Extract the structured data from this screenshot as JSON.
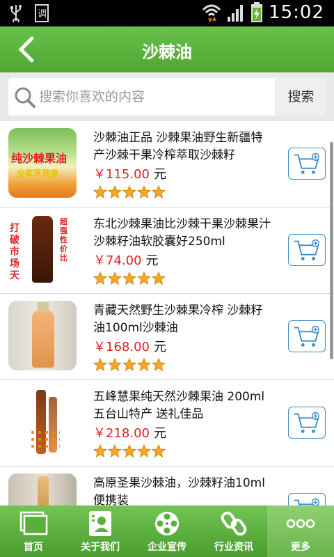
{
  "status_bar": {
    "time": "15:02"
  },
  "header": {
    "title": "沙棘油"
  },
  "search": {
    "placeholder": "搜索你喜欢的内容",
    "button_label": "搜索"
  },
  "products": [
    {
      "name": "沙棘油正品 沙棘果油野生新疆特产沙棘干果冷榨萃取沙棘籽",
      "price": "￥115.00",
      "unit": "元",
      "rating": 5,
      "thumb_text": "纯沙棘果油",
      "thumb_sub": "全家享健康"
    },
    {
      "name": "东北沙棘果油比沙棘干果沙棘果汁沙棘籽油软胶囊好250ml",
      "price": "￥74.00",
      "unit": "元",
      "rating": 5,
      "thumb_text": "打破市场天",
      "thumb_sub": "超强性价比"
    },
    {
      "name": "青藏天然野生沙棘果冷榨 沙棘籽油100ml沙棘油",
      "price": "￥168.00",
      "unit": "元",
      "rating": 5,
      "thumb_text": "",
      "thumb_sub": ""
    },
    {
      "name": "五峰慧果纯天然沙棘果油 200ml 五台山特产 送礼佳品",
      "price": "￥218.00",
      "unit": "元",
      "rating": 5,
      "thumb_text": "",
      "thumb_sub": ""
    },
    {
      "name": "高原圣果沙棘油，沙棘籽油10ml便携装",
      "price": "",
      "unit": "",
      "rating": 0,
      "thumb_text": "",
      "thumb_sub": ""
    }
  ],
  "tabs": [
    {
      "label": "首页",
      "icon": "windows-icon"
    },
    {
      "label": "关于我们",
      "icon": "contact-card-icon"
    },
    {
      "label": "企业宣传",
      "icon": "film-reel-icon"
    },
    {
      "label": "行业资讯",
      "icon": "chain-link-icon"
    },
    {
      "label": "更多",
      "icon": "more-dots-icon"
    }
  ],
  "colors": {
    "brand_green": "#5cb43f",
    "price_red": "#e02020",
    "cart_blue": "#3c8cc8",
    "star_orange": "#f5a623"
  }
}
